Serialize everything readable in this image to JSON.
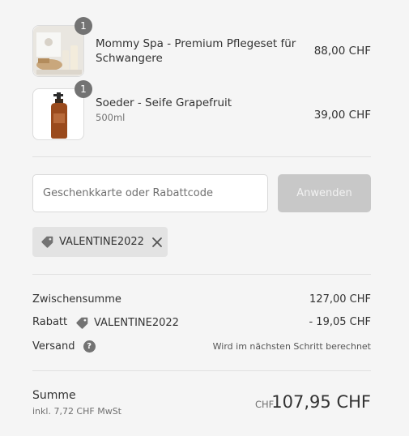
{
  "items": [
    {
      "quantity": "1",
      "title": "Mommy Spa - Premium Pflegeset für Schwangere",
      "variant": "",
      "price": "88,00 CHF"
    },
    {
      "quantity": "1",
      "title": "Soeder - Seife Grapefruit",
      "variant": "500ml",
      "price": "39,00 CHF"
    }
  ],
  "discount_form": {
    "placeholder": "Geschenkkarte oder Rabattcode",
    "apply_label": "Anwenden",
    "applied_code": "VALENTINE2022"
  },
  "summary": {
    "subtotal_label": "Zwischensumme",
    "subtotal_value": "127,00 CHF",
    "discount_label": "Rabatt",
    "discount_code": "VALENTINE2022",
    "discount_value": "- 19,05 CHF",
    "shipping_label": "Versand",
    "shipping_value": "Wird im nächsten Schritt berechnet"
  },
  "total": {
    "label": "Summe",
    "tax_note": "inkl. 7,72 CHF MwSt",
    "currency": "CHF",
    "value": "107,95 CHF"
  },
  "colors": {
    "badge": "#737373",
    "apply_disabled": "#c8c8c8",
    "tag_bg": "#e3e3e3"
  },
  "icons": {
    "tag": "tag-icon",
    "remove": "close-icon",
    "help": "question-circle-icon"
  }
}
